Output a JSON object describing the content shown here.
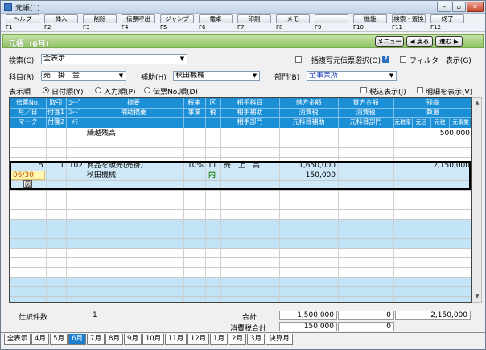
{
  "window": {
    "title": "元帳(1)"
  },
  "fkeys": [
    {
      "label": "ヘルプ",
      "key": "F1"
    },
    {
      "label": "挿入",
      "key": "F2"
    },
    {
      "label": "削除",
      "key": "F3"
    },
    {
      "label": "伝票呼出",
      "key": "F4"
    },
    {
      "label": "ジャンプ",
      "key": "F5"
    },
    {
      "label": "電卓",
      "key": "F6"
    },
    {
      "label": "印刷",
      "key": "F7"
    },
    {
      "label": "メモ",
      "key": "F8"
    },
    {
      "label": "",
      "key": "F9"
    },
    {
      "label": "機能",
      "key": "F10"
    },
    {
      "label": "検索・置換",
      "key": "F11"
    },
    {
      "label": "終了",
      "key": "F12"
    }
  ],
  "title_bar": {
    "title": "元帳（6月）",
    "menu": "メニュー",
    "back": "◀ 戻る",
    "next": "進む ▶"
  },
  "filters": {
    "search_label": "検索(C)",
    "search_value": "全表示",
    "batch_copy_label": "一括複写元伝票選択(O)",
    "batch_copy_checked": false,
    "filter_label": "フィルター表示(G)",
    "filter_checked": false,
    "account_label": "科目(R)",
    "account_value": "売　掛　金",
    "sub_label": "補助(H)",
    "sub_value": "秋田機械",
    "dept_label": "部門(B)",
    "dept_value": "全事業所",
    "order_label": "表示順",
    "order_options": [
      "日付順(Y)",
      "入力順(P)",
      "伝票No.順(D)"
    ],
    "order_selected": 0,
    "tax_incl_label": "税込表示(J)",
    "tax_incl_checked": false,
    "detail_label": "明細を表示(V)",
    "detail_checked": false
  },
  "grid_header": {
    "row1": [
      "伝票No.",
      "取引",
      "ｺｰﾄﾞ",
      "摘要",
      "税率",
      "区",
      "相手科目",
      "借方金額",
      "貸方金額",
      "残高"
    ],
    "row2": [
      "月／日",
      "付箋1",
      "ｺｰﾄﾞ",
      "補助摘要",
      "事業",
      "税",
      "相手補助",
      "消費税",
      "消費税",
      "数量"
    ],
    "row3": [
      "マーク",
      "付箋2",
      "ﾒﾓ",
      "",
      "",
      "",
      "相手部門",
      "元科目補助",
      "元科目部門",
      "元税率",
      "元区",
      "元税",
      "元事業"
    ]
  },
  "grid": {
    "carry_over_label": "繰越残高",
    "carry_over_balance": "500,000",
    "row": {
      "no": "5",
      "torihiki": "1",
      "code": "102",
      "summary": "商品を販売(売掛)",
      "tax_rate": "10%",
      "ku": "11",
      "partner": "売　上　高",
      "debit": "1,650,000",
      "balance": "2,150,000",
      "date": "06/30",
      "sub_summary": "秋田機械",
      "tax_mark": "内",
      "debit_tax": "150,000",
      "mark": "図"
    }
  },
  "footer": {
    "count_label": "仕訳件数",
    "count": "1",
    "total_label": "合計",
    "total_debit": "1,500,000",
    "total_credit": "0",
    "total_balance": "2,150,000",
    "tax_total_label": "消費税合計",
    "tax_debit": "150,000",
    "tax_credit": "0"
  },
  "tabs": [
    "全表示",
    "4月",
    "5月",
    "6月",
    "7月",
    "8月",
    "9月",
    "10月",
    "11月",
    "12月",
    "1月",
    "2月",
    "3月",
    "決算月"
  ],
  "active_tab": 3
}
